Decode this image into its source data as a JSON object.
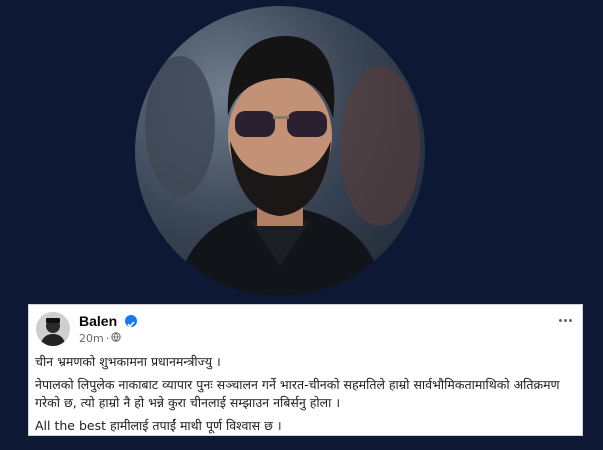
{
  "post": {
    "author": "Balen",
    "time": "20m",
    "verified_color": "#1877f2",
    "paragraphs": [
      "चीन भ्रमणको शुभकामना प्रधानमन्त्रीज्यु ।",
      "नेपालको लिपुलेक नाकाबाट व्यापार पुनः सञ्चालन गर्ने भारत-चीनको सहमतिले हाम्रो सार्वभौमिकतामाथिको अतिक्रमण गरेको छ, त्यो हाम्रो नै हो भन्ने कुरा चीनलाई सम्झाउन नबिर्सनु होला ।",
      "All the best हामीलाई तपाईं माथी पूर्ण विश्वास छ ।"
    ]
  },
  "icons": {
    "privacy": "globe-icon",
    "verified": "verified-badge-icon",
    "menu": "more-options-icon"
  }
}
